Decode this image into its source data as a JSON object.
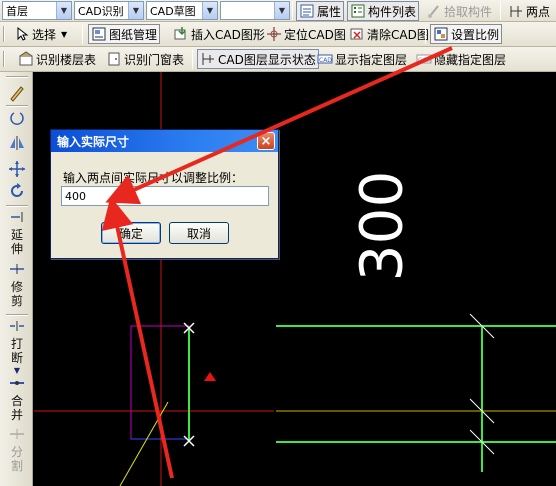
{
  "toolbar_top": {
    "floor_combo": "首层",
    "cad_recognize_combo": "CAD识别",
    "cad_draft_combo": "CAD草图",
    "empty_combo": "",
    "properties": "属性",
    "component_list": "构件列表",
    "pick_component": "拾取构件",
    "two_points": "两点"
  },
  "toolbar_mid": {
    "select": "选择",
    "drawing_management": "图纸管理",
    "insert_cad": "插入CAD图形",
    "locate_cad": "定位CAD图",
    "clear_cad": "清除CAD图",
    "set_scale": "设置比例"
  },
  "toolbar_low": {
    "recognize_floor_table": "识别楼层表",
    "recognize_door_window_table": "识别门窗表",
    "cad_layer_display": "CAD图层显示状态",
    "show_layer": "显示指定图层",
    "hide_layer": "隐藏指定图层"
  },
  "left_tools": {
    "extend_1": "延",
    "extend_2": "伸",
    "trim_1": "修",
    "trim_2": "剪",
    "break_1": "打",
    "break_2": "断",
    "merge_1": "合",
    "merge_2": "并",
    "split_1": "分",
    "split_2": "割"
  },
  "canvas": {
    "dimension_text": "300"
  },
  "dialog": {
    "title": "输入实际尺寸",
    "prompt": "输入两点间实际尺寸以调整比例：",
    "value": "400",
    "ok": "确定",
    "cancel": "取消",
    "close": "×"
  },
  "colors": {
    "green_line": "#3ee63e",
    "red_axis": "#c81414",
    "yellow_line": "#e6e600",
    "magenta_rect": "#c000c0",
    "annotation_arrow": "#e8281e"
  }
}
